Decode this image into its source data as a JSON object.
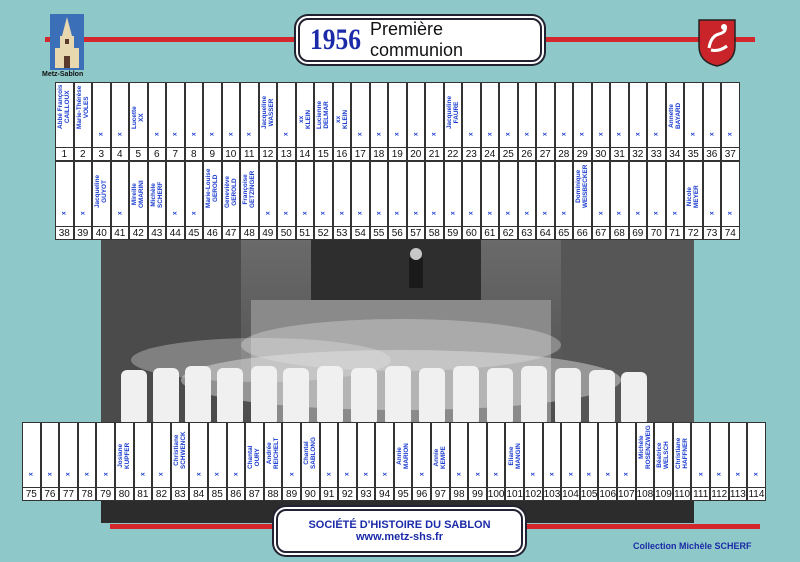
{
  "title": {
    "year": "1956",
    "subtitle": "Première communion"
  },
  "logo_caption": "Metz-Sablon",
  "footer": {
    "line1": "SOCIÉTÉ D'HISTOIRE DU SABLON",
    "line2": "www.metz-shs.fr"
  },
  "collection": "Collection Michèle SCHERF",
  "row1": {
    "numbers": [
      "1",
      "2",
      "3",
      "4",
      "5",
      "6",
      "7",
      "8",
      "9",
      "10",
      "11",
      "12",
      "13",
      "14",
      "15",
      "16",
      "17",
      "18",
      "19",
      "20",
      "21",
      "22",
      "23",
      "24",
      "25",
      "26",
      "27",
      "28",
      "29",
      "30",
      "31",
      "32",
      "33",
      "34",
      "35",
      "36",
      "37"
    ],
    "names": [
      "Abbé François\nCAILLOUX",
      "Marie-Thérèse\nVOLES",
      "x",
      "x",
      "Lucette\nXX",
      "x",
      "x",
      "x",
      "x",
      "x",
      "x",
      "Jacqueline\nWASSER",
      "x",
      "xx\nKLEIN",
      "Lucienne\nDELMAR",
      "xx\nKLEIN",
      "x",
      "x",
      "x",
      "x",
      "x",
      "Jacqueline\nFAURE",
      "x",
      "x",
      "x",
      "x",
      "x",
      "x",
      "x",
      "x",
      "x",
      "x",
      "x",
      "Annette\nBAYARD",
      "x",
      "x",
      "x"
    ]
  },
  "row2": {
    "numbers": [
      "38",
      "39",
      "40",
      "41",
      "42",
      "43",
      "44",
      "45",
      "46",
      "47",
      "48",
      "49",
      "50",
      "51",
      "52",
      "53",
      "54",
      "55",
      "56",
      "57",
      "58",
      "59",
      "60",
      "61",
      "62",
      "63",
      "64",
      "65",
      "66",
      "67",
      "68",
      "69",
      "70",
      "71",
      "72",
      "73",
      "74"
    ],
    "names": [
      "x",
      "x",
      "Jacqueline\nGUYOT",
      "x",
      "Mireille\nOMARINI",
      "Michèle\nSCHERF",
      "x",
      "x",
      "Marie-Louise\nGEROLD",
      "Geneviève\nGEROLD",
      "Françoise\nGETZINGER",
      "x",
      "x",
      "x",
      "x",
      "x",
      "x",
      "x",
      "x",
      "x",
      "x",
      "x",
      "x",
      "x",
      "x",
      "x",
      "x",
      "x",
      "Dominique\nWEISBECKER",
      "x",
      "x",
      "x",
      "x",
      "x",
      "Nicole\nMEYER",
      "x",
      "x"
    ]
  },
  "row3": {
    "numbers": [
      "75",
      "76",
      "77",
      "78",
      "79",
      "80",
      "81",
      "82",
      "83",
      "84",
      "85",
      "86",
      "87",
      "88",
      "89",
      "90",
      "91",
      "92",
      "93",
      "94",
      "95",
      "96",
      "97",
      "98",
      "99",
      "100",
      "101",
      "102",
      "103",
      "104",
      "105",
      "106",
      "107",
      "108",
      "109",
      "110",
      "111",
      "112",
      "113",
      "114"
    ],
    "names": [
      "x",
      "x",
      "x",
      "x",
      "x",
      "Josiane\nKUPFER",
      "x",
      "x",
      "Christiane\nSCHWENCK",
      "x",
      "x",
      "x",
      "Chantal\nOURY",
      "Andrée\nREICHELT",
      "x",
      "Chantal\nSABLONG",
      "x",
      "x",
      "x",
      "x",
      "Annie\nMARION",
      "x",
      "Annie\nKEMPE",
      "x",
      "x",
      "x",
      "Eliane\nMANGIN",
      "x",
      "x",
      "x",
      "x",
      "x",
      "x",
      "Michèle\nROSENZWEIG",
      "Béatrice\nWELSCH",
      "Christiane\nHAFFNER",
      "x",
      "x",
      "x",
      "x"
    ]
  }
}
